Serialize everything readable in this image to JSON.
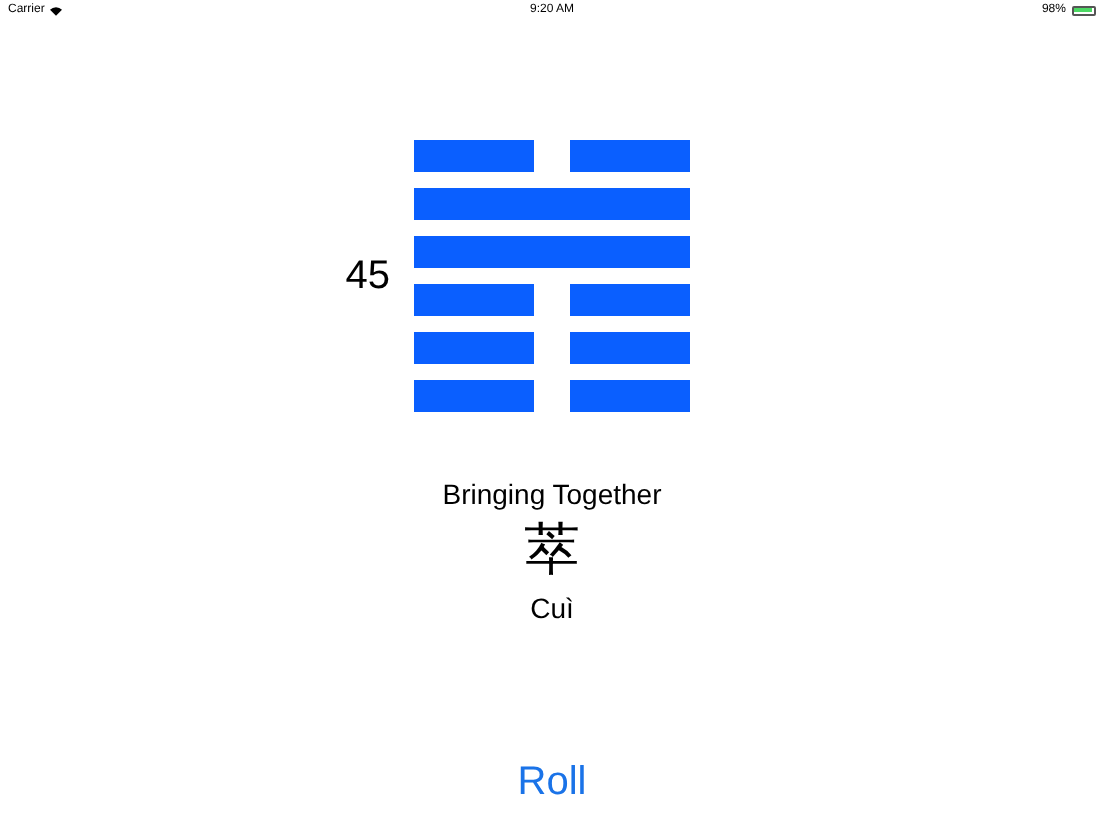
{
  "status_bar": {
    "carrier": "Carrier",
    "time": "9:20 AM",
    "battery": "98%"
  },
  "hexagram": {
    "number": "45",
    "lines": [
      {
        "kind": "broken"
      },
      {
        "kind": "solid"
      },
      {
        "kind": "solid"
      },
      {
        "kind": "broken"
      },
      {
        "kind": "broken"
      },
      {
        "kind": "broken"
      }
    ],
    "name": "Bringing Together",
    "character": "萃",
    "pinyin": "Cuì"
  },
  "button": "Roll"
}
